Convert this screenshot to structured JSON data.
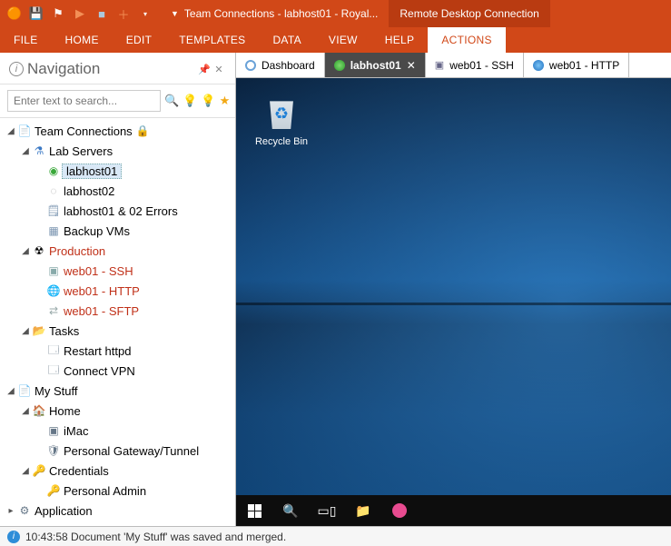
{
  "titlebar": {
    "breadcrumb": "Team Connections - labhost01 - Royal...",
    "context_tab": "Remote Desktop Connection"
  },
  "menubar": {
    "items": [
      "FILE",
      "HOME",
      "EDIT",
      "TEMPLATES",
      "DATA",
      "VIEW",
      "HELP",
      "ACTIONS"
    ],
    "active_index": 7
  },
  "navigation": {
    "title": "Navigation",
    "search_placeholder": "Enter text to search...",
    "tree": {
      "root1": {
        "label": "Team Connections"
      },
      "lab_servers": {
        "label": "Lab Servers"
      },
      "labhost01": {
        "label": "labhost01"
      },
      "labhost02": {
        "label": "labhost02"
      },
      "labhost_errors": {
        "label": "labhost01 & 02 Errors"
      },
      "backup_vms": {
        "label": "Backup VMs"
      },
      "production": {
        "label": "Production"
      },
      "web01_ssh": {
        "label": "web01 - SSH"
      },
      "web01_http": {
        "label": "web01 - HTTP"
      },
      "web01_sftp": {
        "label": "web01 - SFTP"
      },
      "tasks": {
        "label": "Tasks"
      },
      "restart_httpd": {
        "label": "Restart httpd"
      },
      "connect_vpn": {
        "label": "Connect VPN"
      },
      "root2": {
        "label": "My Stuff"
      },
      "home": {
        "label": "Home"
      },
      "imac": {
        "label": "iMac"
      },
      "personal_gateway": {
        "label": "Personal Gateway/Tunnel"
      },
      "credentials": {
        "label": "Credentials"
      },
      "personal_admin": {
        "label": "Personal Admin"
      },
      "root3": {
        "label": "Application"
      }
    }
  },
  "doc_tabs": {
    "dashboard": "Dashboard",
    "labhost01": "labhost01",
    "web01_ssh": "web01 - SSH",
    "web01_http": "web01 - HTTP",
    "active_index": 1
  },
  "rdp": {
    "recycle_bin": "Recycle Bin"
  },
  "status": {
    "message": "10:43:58 Document 'My Stuff' was saved and merged."
  }
}
